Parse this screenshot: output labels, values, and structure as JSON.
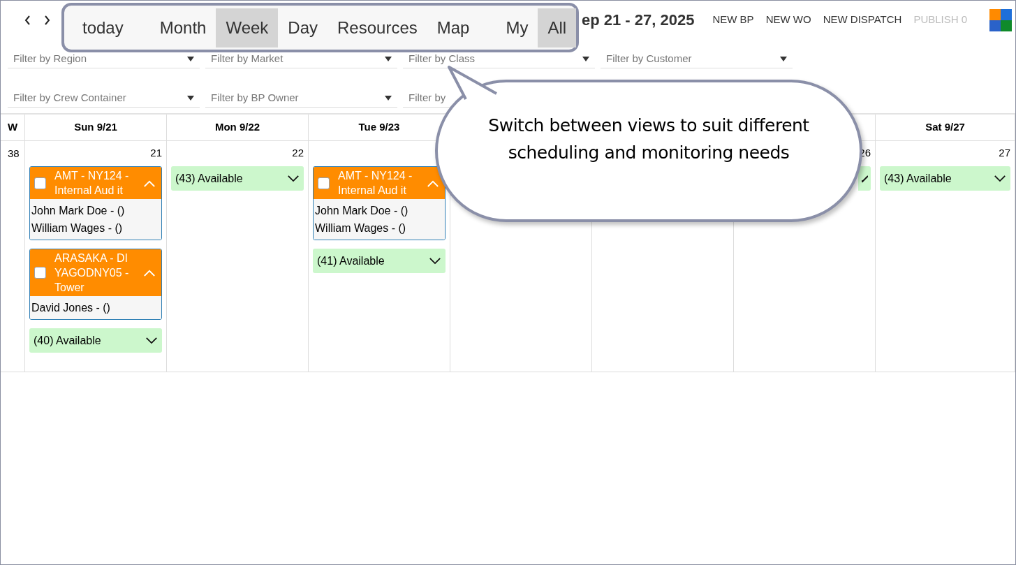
{
  "toolbar": {
    "views": [
      {
        "label": "today",
        "selected": false
      },
      {
        "label": "Month",
        "selected": false
      },
      {
        "label": "Week",
        "selected": true
      },
      {
        "label": "Day",
        "selected": false
      },
      {
        "label": "Resources",
        "selected": false
      },
      {
        "label": "Map",
        "selected": false
      },
      {
        "label": "My",
        "selected": false
      },
      {
        "label": "All",
        "selected": true
      }
    ],
    "title": "ep 21 - 27, 2025",
    "actions": [
      {
        "label": "NEW BP",
        "disabled": false
      },
      {
        "label": "NEW WO",
        "disabled": false
      },
      {
        "label": "NEW DISPATCH",
        "disabled": false
      },
      {
        "label": "PUBLISH 0",
        "disabled": true
      }
    ]
  },
  "filters": [
    {
      "kind": "dropdown",
      "placeholder": "Filter by Region"
    },
    {
      "kind": "dropdown",
      "placeholder": "Filter by Market"
    },
    {
      "kind": "dropdown",
      "placeholder": "Filter by Class"
    },
    {
      "kind": "dropdown",
      "placeholder": "Filter by Customer"
    },
    {
      "kind": "dropdown",
      "placeholder": "Filter by Crew Container"
    },
    {
      "kind": "dropdown",
      "placeholder": "Filter by BP Owner"
    },
    {
      "kind": "field",
      "placeholder": "Filter by"
    }
  ],
  "calendar": {
    "week_header": "W",
    "week_number": "38",
    "days": [
      {
        "kind": "day",
        "header": "Sun 9/21",
        "number": "21",
        "items": [
          {
            "kind": "event",
            "title": "AMT - NY124 - Internal Aud it",
            "checked": false,
            "expanded": true,
            "people": [
              "John Mark Doe - ()",
              "William Wages - ()"
            ]
          },
          {
            "kind": "event",
            "title": "ARASAKA - DI YAGODNY05 - Tower",
            "checked": false,
            "expanded": true,
            "people": [
              "David Jones - ()"
            ]
          },
          {
            "kind": "available",
            "label": "(40) Available",
            "expanded": false
          }
        ]
      },
      {
        "kind": "day",
        "header": "Mon 9/22",
        "number": "22",
        "items": [
          {
            "kind": "available",
            "label": "(43) Available",
            "expanded": false
          }
        ]
      },
      {
        "kind": "day",
        "header": "Tue 9/23",
        "items": [
          {
            "kind": "event",
            "title": "AMT - NY124 - Internal Aud it",
            "checked": false,
            "expanded": true,
            "people": [
              "John Mark Doe - ()",
              "William Wages - ()"
            ]
          },
          {
            "kind": "available",
            "label": "(41) Available",
            "expanded": false
          }
        ]
      },
      {
        "kind": "day"
      },
      {
        "kind": "day"
      },
      {
        "kind": "day",
        "number": "26",
        "items": [
          {
            "kind": "available",
            "expanded": false
          }
        ]
      },
      {
        "kind": "day",
        "header": "Sat 9/27",
        "number": "27",
        "items": [
          {
            "kind": "available",
            "label": "(43) Available",
            "expanded": false
          }
        ]
      }
    ]
  },
  "callout": {
    "text": "Switch between views to suit different scheduling and monitoring needs"
  }
}
